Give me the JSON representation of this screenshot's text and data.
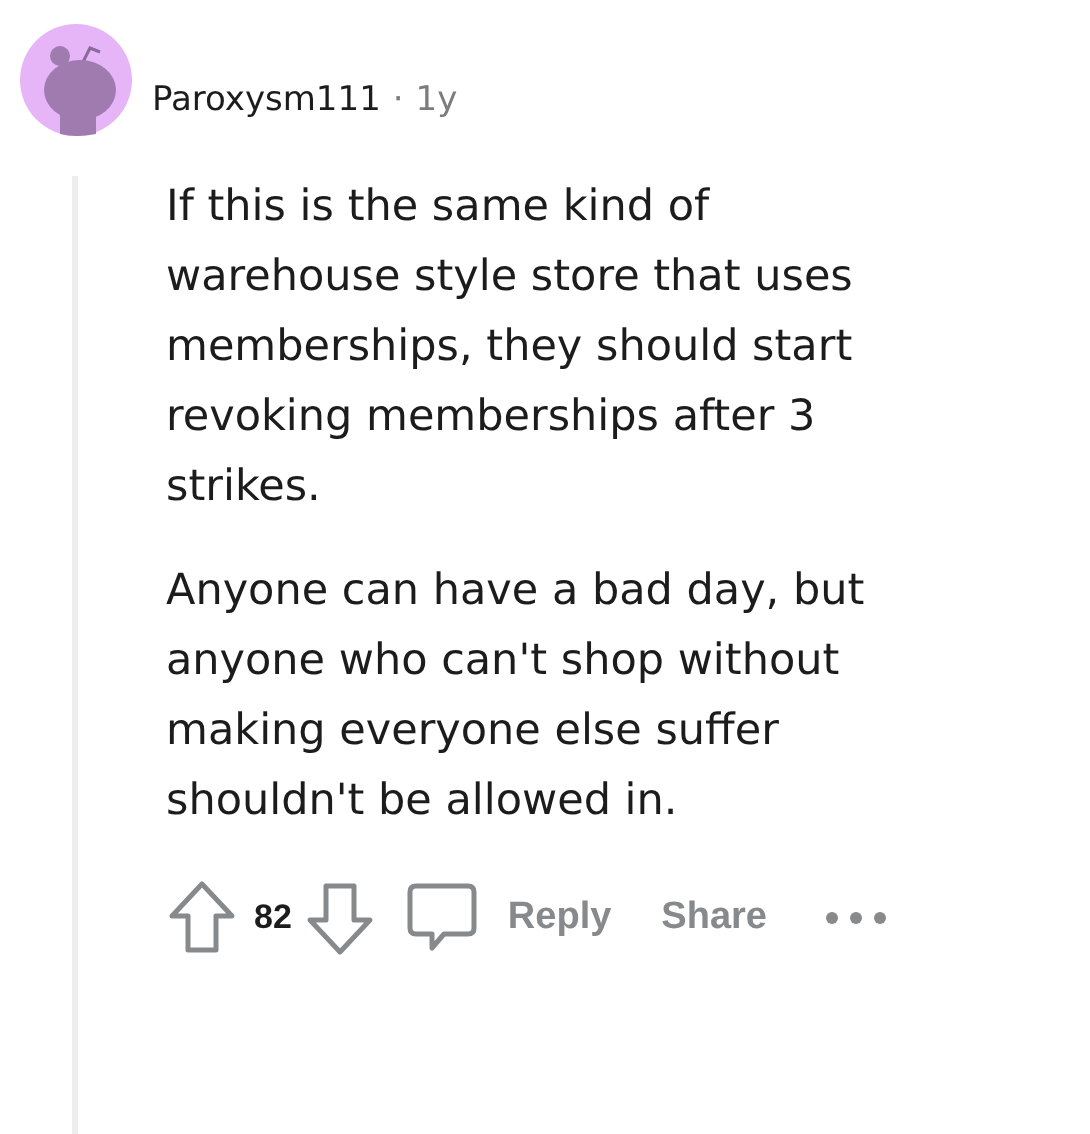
{
  "comment": {
    "author": "Paroxysm111",
    "separator": "·",
    "age": "1y",
    "paragraphs": [
      "If this is the same kind of\nwarehouse style store that uses\nmemberships, they should start\nrevoking memberships after 3\nstrikes.",
      "Anyone can have a bad day, but\nanyone who can't shop without\nmaking everyone else suffer\nshouldn't be allowed in."
    ],
    "score": "82",
    "actions": [
      "Reply",
      "Share"
    ]
  }
}
